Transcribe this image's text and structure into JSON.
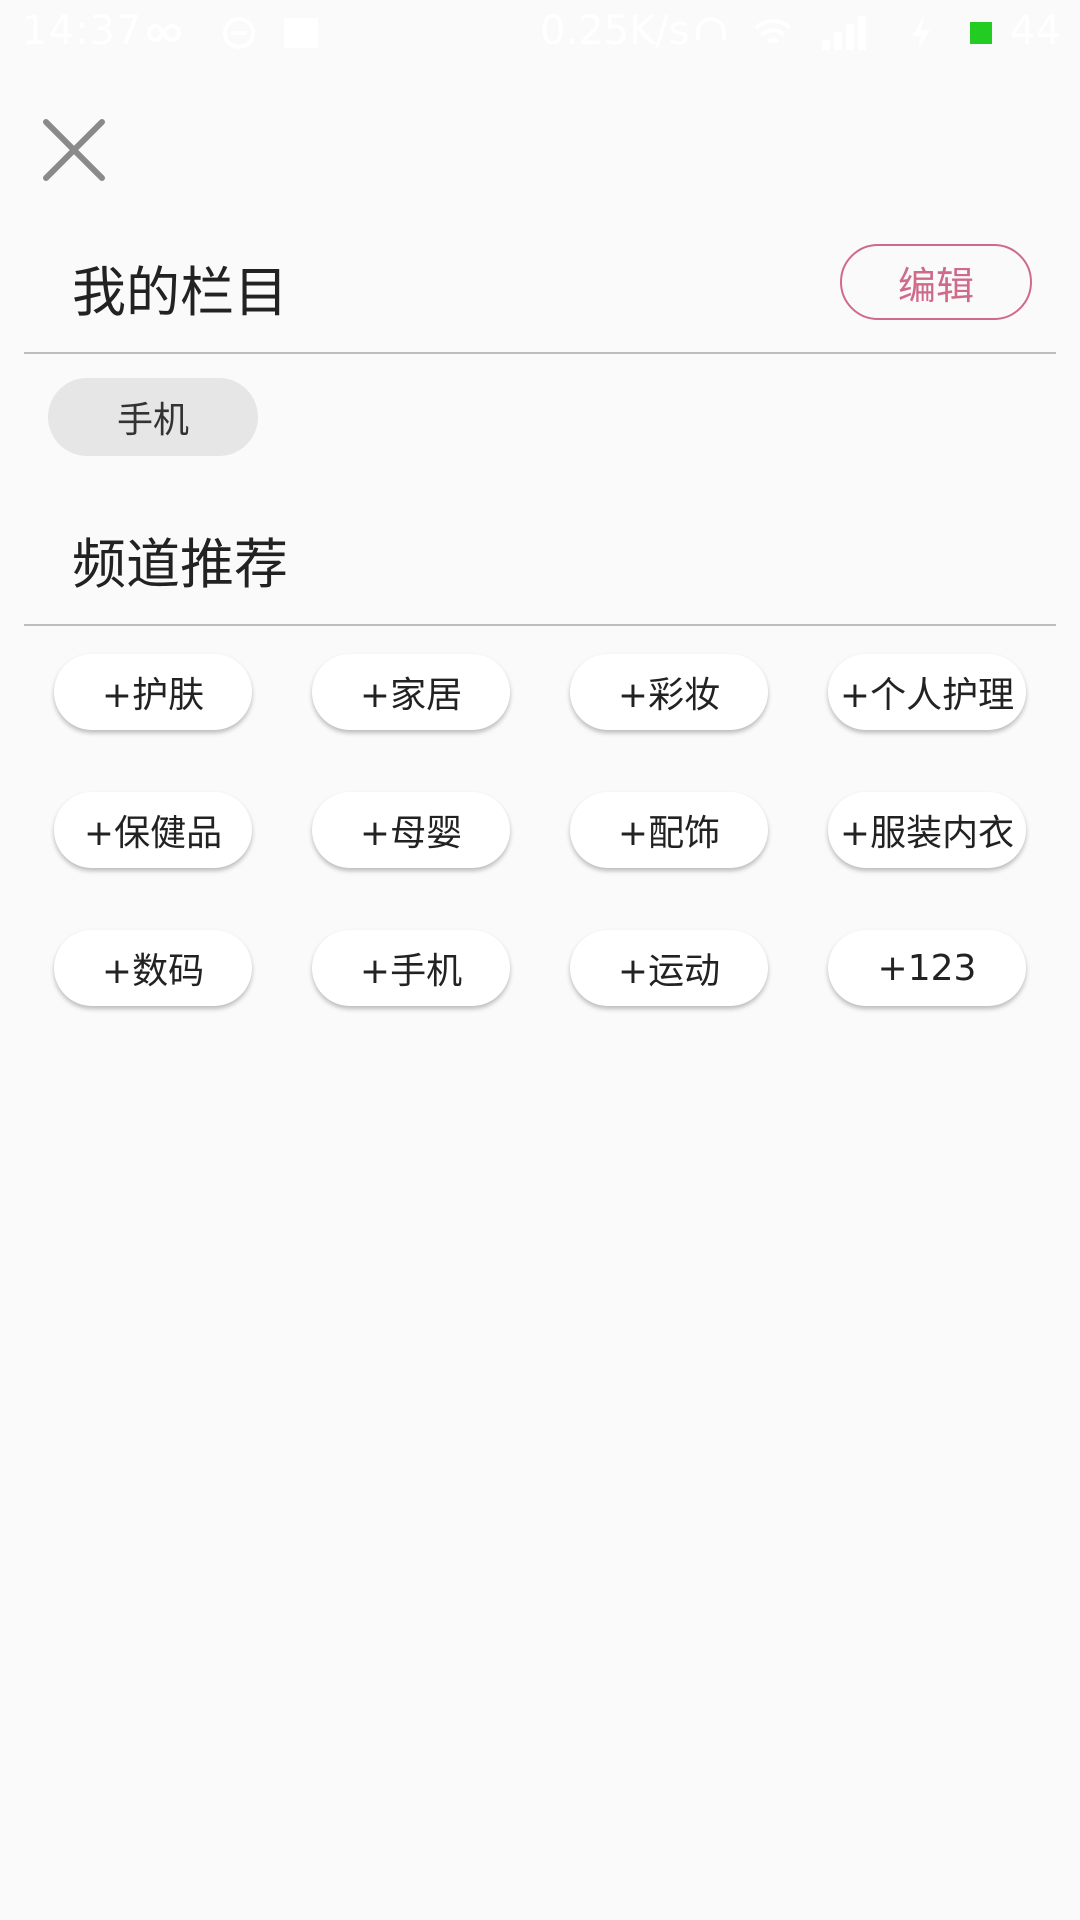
{
  "status_bar": {
    "time": "14:37",
    "net_speed": "0.25K/s",
    "battery": "44"
  },
  "header": {
    "close_icon": "close-icon"
  },
  "my_columns": {
    "title": "我的栏目",
    "edit_label": "编辑",
    "accent_color": "#cf6a8b",
    "items": [
      "手机"
    ]
  },
  "recommended": {
    "title": "频道推荐",
    "items": [
      "+护肤",
      "+家居",
      "+彩妆",
      "+个人护理",
      "+保健品",
      "+母婴",
      "+配饰",
      "+服装内衣",
      "+数码",
      "+手机",
      "+运动",
      "+123"
    ]
  }
}
